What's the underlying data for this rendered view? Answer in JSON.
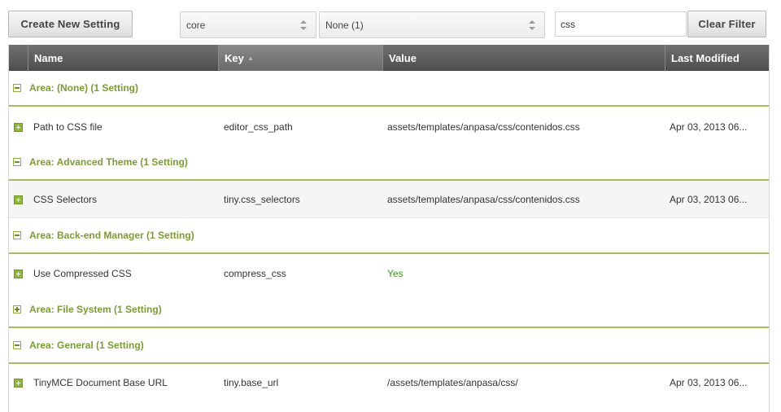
{
  "toolbar": {
    "create_label": "Create New Setting",
    "namespace_value": "core",
    "area_value": "None (1)",
    "search_value": "css",
    "clear_label": "Clear Filter"
  },
  "columns": [
    "Name",
    "Key",
    "Value",
    "Last Modified"
  ],
  "groups": [
    {
      "label": "Area: (None) (1 Setting)",
      "expanded": true
    },
    {
      "label": "Area: Advanced Theme (1 Setting)",
      "expanded": true
    },
    {
      "label": "Area: Back-end Manager (1 Setting)",
      "expanded": true
    },
    {
      "label": "Area: File System (1 Setting)",
      "expanded": false
    },
    {
      "label": "Area: General (1 Setting)",
      "expanded": true
    }
  ],
  "rows": [
    {
      "name": "Path to CSS file",
      "key": "editor_css_path",
      "value": "assets/templates/anpasa/css/contenidos.css",
      "modified": "Apr 03, 2013 06..."
    },
    {
      "name": "CSS Selectors",
      "key": "tiny.css_selectors",
      "value": "assets/templates/anpasa/css/contenidos.css",
      "modified": "Apr 03, 2013 06..."
    },
    {
      "name": "Use Compressed CSS",
      "key": "compress_css",
      "value": "Yes",
      "modified": ""
    },
    {
      "name": "TinyMCE Document Base URL",
      "key": "tiny.base_url",
      "value": "/assets/templates/anpasa/css/",
      "modified": "Apr 03, 2013 06..."
    }
  ],
  "colors": {
    "accent": "#7a9e2d",
    "yes": "#3c9a1e",
    "header": "#5a5a5a"
  },
  "icons": [
    "select-arrows-icon",
    "collapse-icon",
    "expand-icon",
    "row-expand-icon"
  ]
}
